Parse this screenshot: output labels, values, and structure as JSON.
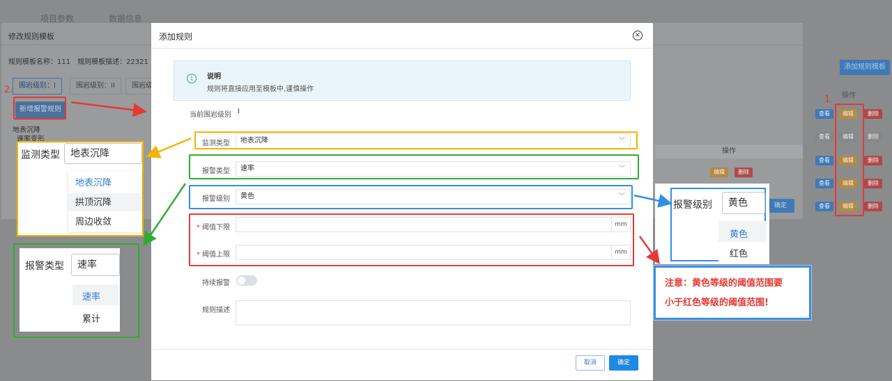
{
  "background": {
    "tabs": [
      "项目参数",
      "数据信息"
    ],
    "add_template_btn": "添加规则模板",
    "op_header": "操作",
    "row_btns": [
      "查看",
      "编辑",
      "删除"
    ]
  },
  "panel": {
    "title": "修改规则模板",
    "meta": "规则模板名称：111　规则模板描述：22321",
    "tabs": [
      "围岩级别：I",
      "围岩级别：II",
      "围岩级"
    ],
    "new_rule_btn": "新增报警规则",
    "row_text_1": "地表沉降",
    "row_text_2": "速率变形",
    "table_op": "操作",
    "inner_btns": [
      "编辑",
      "删除"
    ],
    "confirm": "确定"
  },
  "dialog": {
    "title": "添加规则",
    "notice": {
      "title": "说明",
      "desc": "规则将直接应用至模板中,谨慎操作"
    },
    "current_level_label": "当前围岩级别",
    "current_level_value": "I",
    "monitor_type": {
      "label": "监测类型",
      "value": "地表沉降"
    },
    "alarm_type": {
      "label": "报警类型",
      "value": "速率"
    },
    "alarm_level": {
      "label": "报警级别",
      "value": "黄色"
    },
    "threshold_low": {
      "label": "阈值下限",
      "unit": "mm"
    },
    "threshold_high": {
      "label": "阈值上限",
      "unit": "mm"
    },
    "continuous_alarm": {
      "label": "持续报警",
      "enabled": false
    },
    "rule_desc": {
      "label": "规则描述"
    },
    "cancel": "取消",
    "ok": "确定"
  },
  "callouts": {
    "monitor": {
      "label": "监测类型",
      "value": "地表沉降",
      "options": [
        "地表沉降",
        "拱顶沉降",
        "周边收敛"
      ]
    },
    "alarm_type": {
      "label": "报警类型",
      "value": "速率",
      "options": [
        "速率",
        "累计"
      ]
    },
    "alarm_level": {
      "label": "报警级别",
      "value": "黄色",
      "options": [
        "黄色",
        "红色"
      ]
    },
    "note_line1": "注意：黄色等级的阈值范围要",
    "note_line2": "小于红色等级的阈值范围!",
    "marker_1": "1.",
    "marker_2": "2."
  },
  "colors": {
    "accent": "#1e88e5",
    "yellow_box": "#f5b400",
    "green_box": "#2eae2e",
    "blue_box": "#2f8fe6",
    "red_box": "#e53935"
  }
}
